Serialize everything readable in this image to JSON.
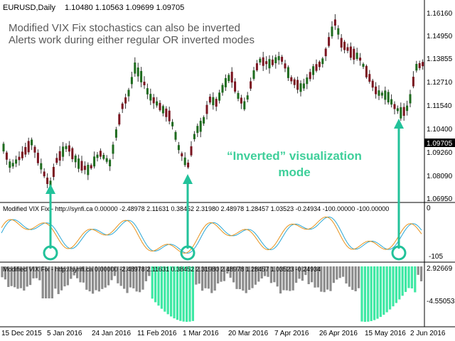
{
  "header": {
    "symbol_tf": "EURUSD,Daily",
    "ohlc": "1.10480 1.10563 1.09699 1.09705"
  },
  "annotations": {
    "line1": "Modified VIX Fix stochastics can also be inverted",
    "line2": "Alerts work during either regular OR inverted modes",
    "mode_line1": "“Inverted” visualization",
    "mode_line2": "mode"
  },
  "price_axis": {
    "ticks": [
      "1.16160",
      "1.14950",
      "1.13855",
      "1.12710",
      "1.11540",
      "1.10400",
      "1.09260",
      "1.08090",
      "1.06950"
    ],
    "current_price": "1.09705"
  },
  "indicator1": {
    "label": "Modified VIX Fix - http://synfi.ca 0.00000 -2.48978 2.11631 0.38452 2.31980 2.48978 1.28457 1.03523 -0.24934 -100.00000 -100.00000",
    "ticks": [
      "0",
      "-105"
    ]
  },
  "indicator2": {
    "label": "Modified VIX Fix - http://synfi.ca 0.00000 -2.48978 2.11631 0.38452 2.31980 2.48978 1.28457 1.03523 -0.24934",
    "ticks": [
      "2.92669",
      "-4.55053"
    ]
  },
  "time_axis": {
    "labels": [
      "15 Dec 2015",
      "5 Jan 2016",
      "24 Jan 2016",
      "11 Feb 2016",
      "1 Mar 2016",
      "20 Mar 2016",
      "7 Apr 2016",
      "26 Apr 2016",
      "15 May 2016",
      "2 Jun 2016"
    ]
  },
  "colors": {
    "bull": "#1e6b1e",
    "bear": "#7a1420",
    "stoch_main": "#2aa7d6",
    "stoch_signal": "#e8921c",
    "hist_gray": "#8c8c8c",
    "hist_teal": "#3ee8a4",
    "arrow": "#22c29a",
    "text_gray": "#5a5a5a"
  }
}
